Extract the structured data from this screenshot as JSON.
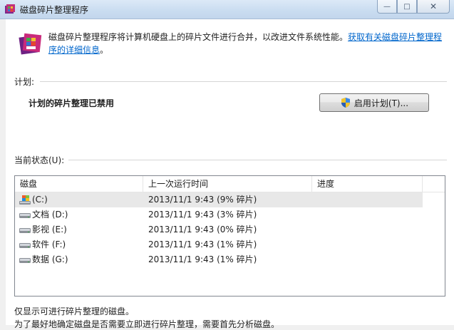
{
  "window": {
    "title": "磁盘碎片整理程序",
    "buttons": {
      "minimize": "—",
      "maximize": "□",
      "close": "✕"
    }
  },
  "header": {
    "description": "磁盘碎片整理程序将计算机硬盘上的碎片文件进行合并，以改进文件系统性能。",
    "link": "获取有关磁盘碎片整理程序的详细信息",
    "link_suffix": "。"
  },
  "schedule": {
    "label": "计划:",
    "status": "计划的碎片整理已禁用",
    "enable_button": "启用计划(T)..."
  },
  "current_status": {
    "label": "当前状态(U):",
    "columns": [
      "磁盘",
      "上一次运行时间",
      "进度"
    ],
    "rows": [
      {
        "disk": "(C:)",
        "last_run": "2013/11/1 9:43 (9% 碎片)",
        "progress": "",
        "icon": "system-drive-icon",
        "selected": true
      },
      {
        "disk": "文档 (D:)",
        "last_run": "2013/11/1 9:43 (3% 碎片)",
        "progress": "",
        "icon": "drive-icon"
      },
      {
        "disk": "影视 (E:)",
        "last_run": "2013/11/1 9:43 (0% 碎片)",
        "progress": "",
        "icon": "drive-icon"
      },
      {
        "disk": "软件 (F:)",
        "last_run": "2013/11/1 9:43 (1% 碎片)",
        "progress": "",
        "icon": "drive-icon"
      },
      {
        "disk": "数据 (G:)",
        "last_run": "2013/11/1 9:43 (1% 碎片)",
        "progress": "",
        "icon": "drive-icon"
      }
    ]
  },
  "footer": {
    "line1": "仅显示可进行碎片整理的磁盘。",
    "line2": "为了最好地确定磁盘是否需要立即进行碎片整理，需要首先分析磁盘。"
  },
  "colors": {
    "link": "#0066cc",
    "titlebar": "#c9dcf0",
    "selected_row": "#e8e8e8"
  }
}
